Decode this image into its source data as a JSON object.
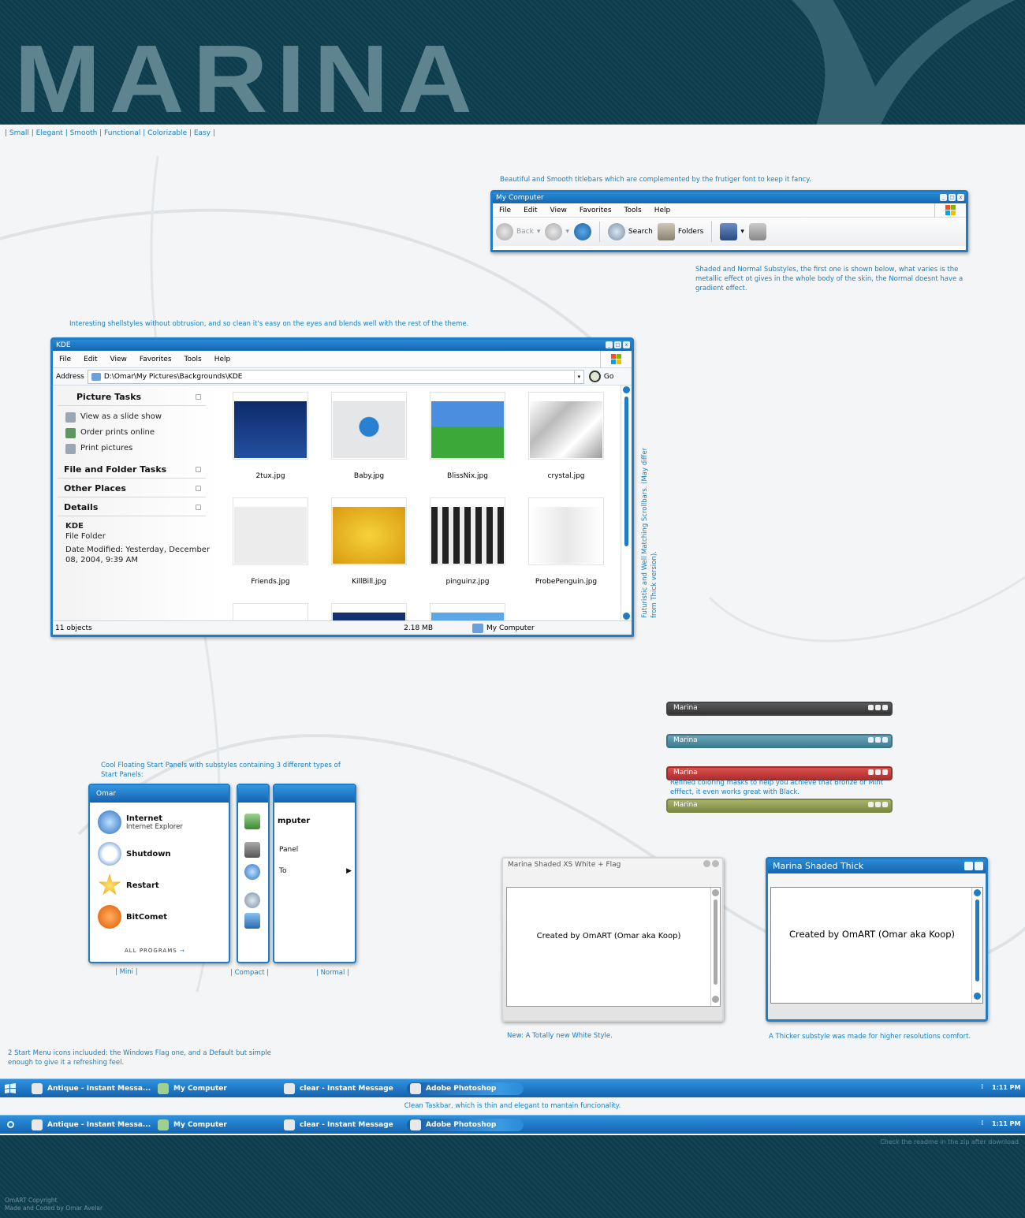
{
  "header": {
    "logo": "MARINA"
  },
  "tagline": "| Small | Elegant | Smooth | Functional | Colorizable | Easy |",
  "captions": {
    "titlebars": "Beautiful and Smooth titlebars which are complemented by the frutiger font to keep it fancy.",
    "substyles": "Shaded and Normal Substyles, the first one is shown below, what varies is the metallic effect ot gives in the whole body of the skin, the Normal doesnt have a gradient effect.",
    "shellstyles": "Interesting shellstyles without obtrusion, and so clean it's easy on the eyes and blends well with the rest of the theme.",
    "scrollbars": "Futuristic and Well Matching Scrollbars. (May differ from Thick version).",
    "coloring": "Refined coloring masks to help you achieve that Bronze or Mint efffect, it even works great with Black.",
    "startpanels": "Cool Floating Start Panels with substyles containing 3 different types of Start Panels:",
    "white_style": "New: A Totally new White Style.",
    "thick_style": "A Thicker substyle was made for higher resolutions comfort.",
    "start_icons": "2 Start Menu icons incluuded: the Windows Flag one, and a Default but simple enough to give it a refreshing feel.",
    "taskbar": "Clean Taskbar, which is thin and elegant to mantain funcionality.",
    "readme": "Check the readme in the zip after download",
    "copyright": "OmART Copyright",
    "made_by": "Made and Coded by Omar Avelar"
  },
  "mycomputer": {
    "title": "My Computer",
    "menu": [
      "File",
      "Edit",
      "View",
      "Favorites",
      "Tools",
      "Help"
    ],
    "toolbar": {
      "back": "Back",
      "search": "Search",
      "folders": "Folders"
    }
  },
  "kde": {
    "title": "KDE",
    "menu": [
      "File",
      "Edit",
      "View",
      "Favorites",
      "Tools",
      "Help"
    ],
    "address_label": "Address",
    "address_value": "D:\\Omar\\My Pictures\\Backgrounds\\KDE",
    "go": "Go",
    "picture_tasks": {
      "title": "Picture Tasks",
      "items": [
        "View as a slide show",
        "Order prints online",
        "Print pictures"
      ]
    },
    "file_folder_tasks": "File and Folder Tasks",
    "other_places": "Other Places",
    "details": {
      "title": "Details",
      "name": "KDE",
      "type": "File Folder",
      "modified": "Date Modified: Yesterday, December 08, 2004, 9:39 AM"
    },
    "files": [
      "2tux.jpg",
      "Baby.jpg",
      "BlissNix.jpg",
      "crystal.jpg",
      "Friends.jpg",
      "KillBill.jpg",
      "pinguinz.jpg",
      "ProbePenguin.jpg"
    ],
    "status": {
      "objects": "11 objects",
      "size": "2.18 MB",
      "location": "My Computer"
    }
  },
  "color_bars": [
    {
      "label": "Marina",
      "color": "#454545"
    },
    {
      "label": "Marina",
      "color": "#4f8ea0"
    },
    {
      "label": "Marina",
      "color": "#c23d3b"
    },
    {
      "label": "Marina",
      "color": "#8e9a50"
    }
  ],
  "start_menu": {
    "user": "Omar",
    "items": [
      {
        "title": "Internet",
        "sub": "Internet Explorer"
      },
      {
        "title": "Shutdown",
        "sub": ""
      },
      {
        "title": "Restart",
        "sub": ""
      },
      {
        "title": "BitComet",
        "sub": ""
      }
    ],
    "all_programs": "ALL PROGRAMS",
    "normal_items": [
      "mputer",
      "Panel",
      "To"
    ],
    "labels": {
      "mini": "| Mini |",
      "compact": "| Compact |",
      "normal": "| Normal |"
    }
  },
  "dialogs": {
    "xs_title": "Marina Shaded XS White + Flag",
    "thick_title": "Marina Shaded Thick",
    "body": "Created by OmART (Omar aka Koop)"
  },
  "taskbar": {
    "items": [
      "Antique - Instant Messa...",
      "My Computer",
      "clear - Instant Message",
      "Adobe Photoshop"
    ],
    "clock": "1:11 PM"
  }
}
